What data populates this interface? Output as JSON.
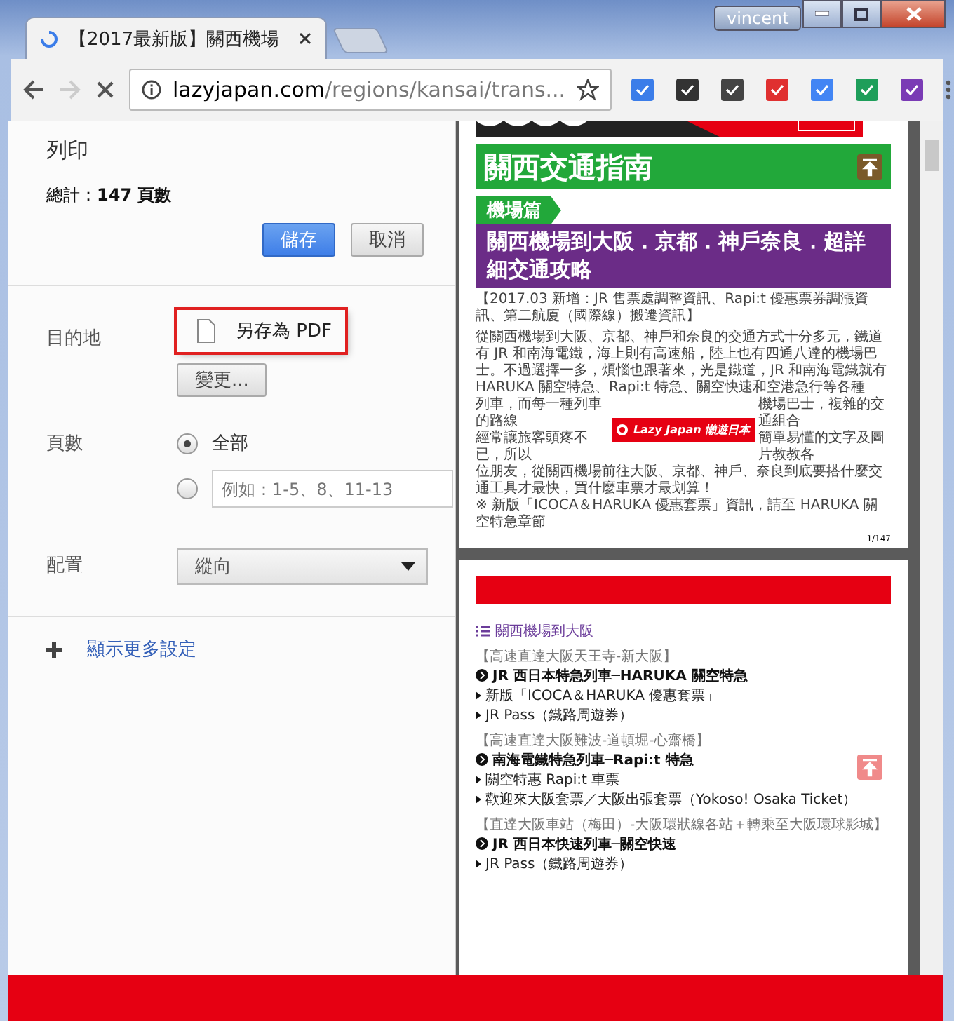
{
  "window": {
    "user": "vincent"
  },
  "tabs": [
    {
      "title": "【2017最新版】關西機場",
      "selected": true,
      "loading": true
    }
  ],
  "nav": {
    "back_enabled": true,
    "forward_enabled": false,
    "loading": true
  },
  "address": {
    "host": "lazyjapan.com",
    "path": "/regions/kansai/trans..."
  },
  "print_dialog": {
    "title": "列印",
    "total": "總計：**147 頁數**",
    "buttons": [
      {
        "label": "儲存",
        "kind": "primary"
      },
      {
        "label": "取消",
        "kind": "secondary"
      }
    ],
    "destination": {
      "label": "目的地",
      "value": "另存為 PDF",
      "highlighted": true,
      "change_button": "變更..."
    },
    "pages": {
      "label": "頁數",
      "options": [
        {
          "kind": "label",
          "label": "全部",
          "selected": true
        },
        {
          "kind": "input",
          "placeholder": "例如：1-5、8、11-13",
          "selected": false
        }
      ]
    },
    "layout": {
      "label": "配置",
      "value": "縱向"
    },
    "more_settings": "顯示更多設定"
  },
  "preview": {
    "page1": {
      "banner": "關西交通指南",
      "section_tag": "機場篇",
      "headline": "關西機場到大阪．京都．神戶奈良．超詳細交通攻略",
      "lines": [
        {
          "text": "【2017.03 新增：JR 售票處調整資訊、Rapi:t 優惠票券調漲資訊、第二航廈（國際線）搬遷資訊】"
        },
        {
          "text": "從關西機場到大阪、京都、神戶和奈良的交通方式十分多元，鐵道有 JR 和南海電鐵，海上則有高速船，陸上也有四通八達的機場巴士。不過選擇一多，煩惱也跟著來，光是鐵道，JR 和南海電鐵就有 HARUKA 關空特急、Rapi:t 特急、關空快速和空港急行等各種"
        }
      ],
      "covered": [
        {
          "left": "列車，而每一種列車的路線",
          "right": "機場巴士，複雜的交通組合"
        },
        {
          "left": "經常讓旅客頭疼不已，所以",
          "right": "簡單易懂的文字及圖片教教各"
        }
      ],
      "overlay_badge": "Lazy Japan 懶遊日本",
      "after": [
        "位朋友，從關西機場前往大阪、京都、神戶、奈良到底要搭什麼交通工具才最快，買什麼車票才最划算！",
        "※ 新版「ICOCA＆HARUKA 優惠套票」資訊，請至 HARUKA 關空特急章節"
      ],
      "page_number": "1/147"
    },
    "page2": {
      "toc_title": "關西機場到大阪",
      "groups": [
        {
          "route": "【高速直達大阪天王寺-新大阪】",
          "train": "JR 西日本特急列車─HARUKA 關空特急",
          "links": [
            "新版「ICOCA＆HARUKA 優惠套票」",
            "JR Pass（鐵路周遊券）"
          ]
        },
        {
          "route": "【高速直達大阪難波-道頓堀-心齋橋】",
          "train": "南海電鐵特急列車─Rapi:t 特急",
          "links": [
            "關空特惠 Rapi:t 車票",
            "歡迎來大阪套票／大阪出張套票（Yokoso! Osaka Ticket）"
          ]
        },
        {
          "route": "【直達大阪車站（梅田）-大阪環狀線各站＋轉乘至大阪環球影城】",
          "train": "JR 西日本快速列車─關空快速",
          "links": [
            "JR Pass（鐵路周遊券）"
          ]
        }
      ]
    }
  }
}
